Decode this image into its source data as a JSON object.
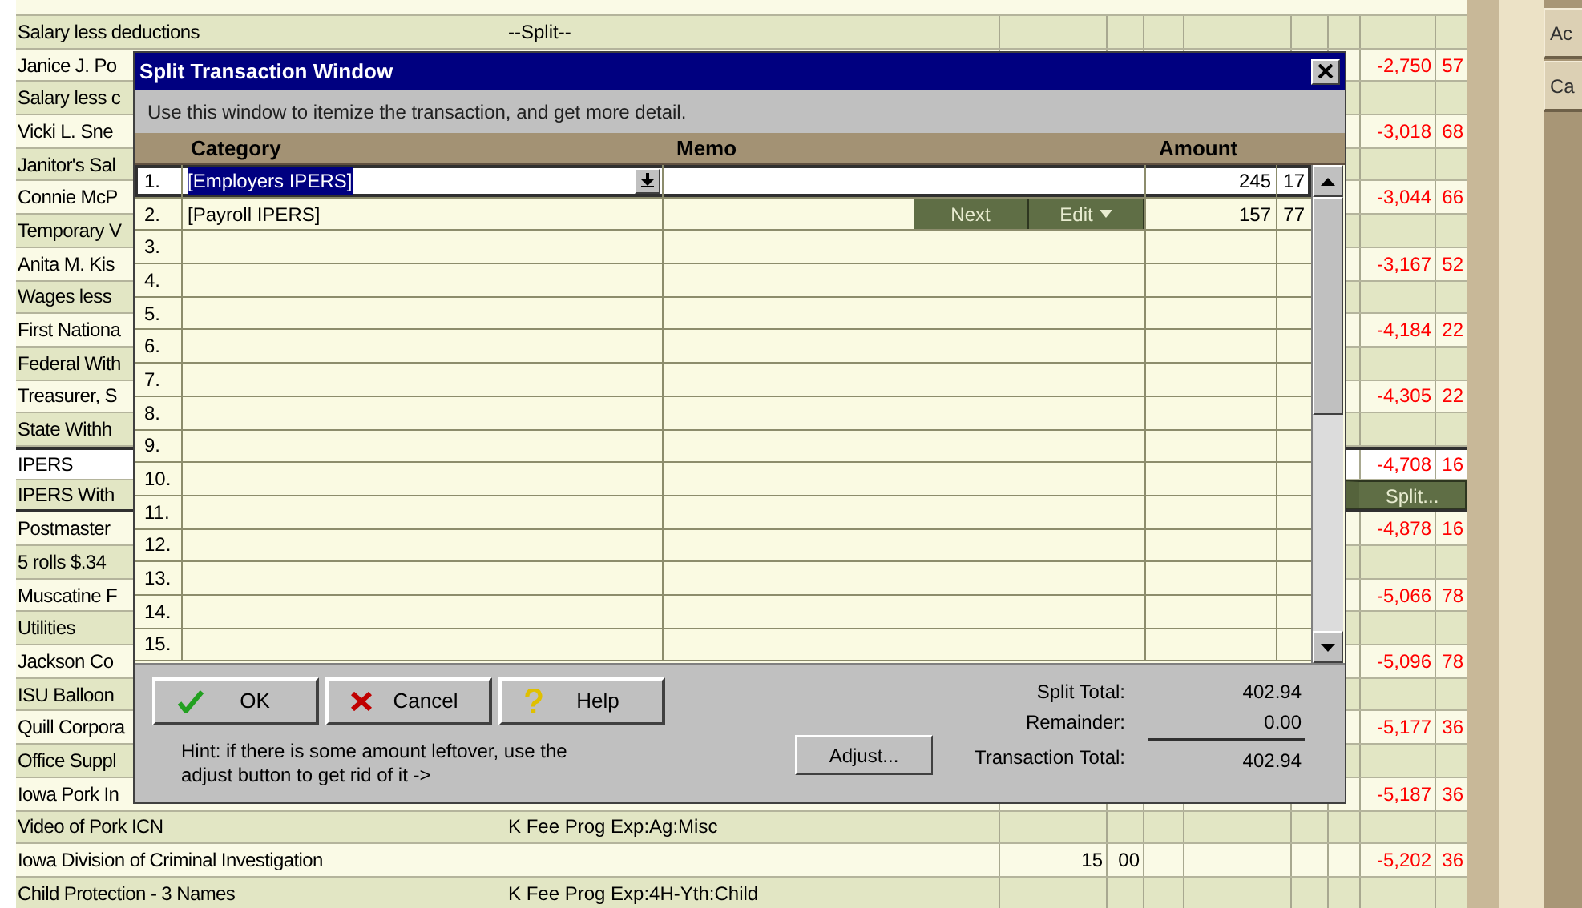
{
  "register": {
    "transactions": [
      {
        "memo": "Salary less deductions",
        "category": "--Split--",
        "selected": false
      },
      {
        "payee": "Janice J. Po",
        "memo": "Salary less c",
        "balance": "-2,750",
        "balance_cents": "57",
        "selected": false
      },
      {
        "payee": "Vicki L. Sne",
        "memo": "Janitor's Sal",
        "balance": "-3,018",
        "balance_cents": "68",
        "selected": false
      },
      {
        "payee": "Connie McP",
        "memo": "Temporary V",
        "balance": "-3,044",
        "balance_cents": "66",
        "selected": false
      },
      {
        "payee": "Anita M. Kis",
        "memo": "Wages less",
        "balance": "-3,167",
        "balance_cents": "52",
        "selected": false
      },
      {
        "payee": "First Nationa",
        "memo": "Federal With",
        "balance": "-4,184",
        "balance_cents": "22",
        "selected": false
      },
      {
        "payee": "Treasurer, S",
        "memo": "State Withh",
        "balance": "-4,305",
        "balance_cents": "22",
        "selected": false
      },
      {
        "payee": "IPERS",
        "memo": "IPERS With",
        "balance": "-4,708",
        "balance_cents": "16",
        "selected": true,
        "split_button": "Split..."
      },
      {
        "payee": "Postmaster",
        "memo": "5  rolls $.34",
        "balance": "-4,878",
        "balance_cents": "16",
        "selected": false
      },
      {
        "payee": "Muscatine F",
        "memo": "Utilities",
        "balance": "-5,066",
        "balance_cents": "78",
        "selected": false
      },
      {
        "payee": "Jackson Co",
        "memo": "ISU Balloon",
        "balance": "-5,096",
        "balance_cents": "78",
        "selected": false
      },
      {
        "payee": "Quill Corpora",
        "memo": "Office Suppl",
        "balance": "-5,177",
        "balance_cents": "36",
        "selected": false
      },
      {
        "payee": "Iowa Pork In",
        "memo": "Video of Pork ICN",
        "category": "K Fee Prog Exp:Ag:Misc",
        "balance": "-5,187",
        "balance_cents": "36",
        "selected": false
      },
      {
        "payee": "Iowa Division of Criminal Investigation",
        "payment": "15",
        "payment_cents": "00",
        "memo": "Child Protection - 3 Names",
        "category": "K Fee Prog Exp:4H-Yth:Child",
        "balance": "-5,202",
        "balance_cents": "36",
        "selected": false
      }
    ]
  },
  "side_buttons": [
    "Ac",
    "Ca"
  ],
  "split_window": {
    "title": "Split Transaction Window",
    "instructions": "Use this window to itemize the transaction, and get more detail.",
    "columns": [
      "Category",
      "Memo",
      "Amount"
    ],
    "lines": [
      {
        "number": "1.",
        "category": "[Employers IPERS]",
        "amount": "245",
        "cents": "17",
        "selected": true
      },
      {
        "number": "2.",
        "category": "[Payroll IPERS]",
        "amount": "157",
        "cents": "77",
        "selected": false,
        "buttons": [
          {
            "label": "Next",
            "menu": false
          },
          {
            "label": "Edit",
            "menu": true
          }
        ]
      },
      {
        "number": "3.",
        "selected": false
      },
      {
        "number": "4.",
        "selected": false
      },
      {
        "number": "5.",
        "selected": false
      },
      {
        "number": "6.",
        "selected": false
      },
      {
        "number": "7.",
        "selected": false
      },
      {
        "number": "8.",
        "selected": false
      },
      {
        "number": "9.",
        "selected": false
      },
      {
        "number": "10.",
        "selected": false
      },
      {
        "number": "11.",
        "selected": false
      },
      {
        "number": "12.",
        "selected": false
      },
      {
        "number": "13.",
        "selected": false
      },
      {
        "number": "14.",
        "selected": false
      },
      {
        "number": "15.",
        "selected": false
      }
    ],
    "buttons": [
      {
        "kind": "ok",
        "label": "OK"
      },
      {
        "kind": "cancel",
        "label": "Cancel"
      },
      {
        "kind": "help",
        "label": "Help"
      }
    ],
    "hint": "Hint: if there is some amount leftover, use the adjust button to get rid of it ->",
    "adjust_button": "Adjust...",
    "totals": [
      {
        "label": "Split Total:",
        "value": "402.94"
      },
      {
        "label": "Remainder:",
        "value": "0.00"
      },
      {
        "label": "Transaction Total:",
        "value": "402.94"
      }
    ]
  }
}
